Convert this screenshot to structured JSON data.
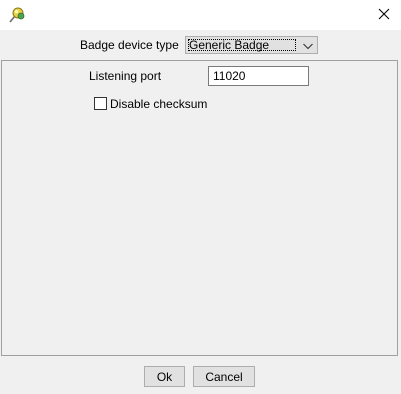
{
  "titlebar": {
    "app_icon": "pushpin-icon",
    "close_icon": "close-icon"
  },
  "form": {
    "badge_device_type_label": "Badge device type",
    "badge_device_type_value": "Generic Badge",
    "listening_port_label": "Listening port",
    "listening_port_value": "11020",
    "disable_checksum_label": "Disable checksum",
    "disable_checksum_checked": false
  },
  "buttons": {
    "ok": "Ok",
    "cancel": "Cancel"
  }
}
